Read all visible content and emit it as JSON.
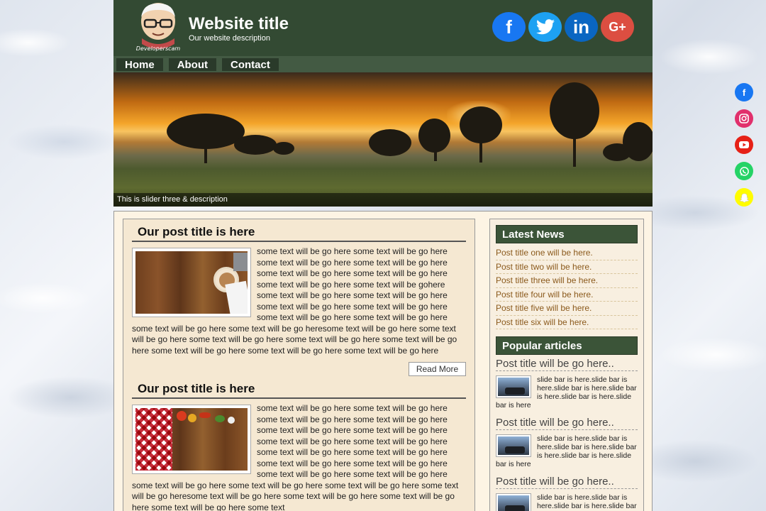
{
  "header": {
    "site_title": "Website title",
    "site_description": "Our website description",
    "logo_text": "Developerscam",
    "socials": [
      "facebook-icon",
      "twitter-icon",
      "linkedin-icon",
      "google-plus-icon"
    ],
    "google_plus_label": "G+",
    "linkedin_label": "in"
  },
  "nav": {
    "items": [
      {
        "label": "Home"
      },
      {
        "label": "About"
      },
      {
        "label": "Contact"
      }
    ]
  },
  "slider": {
    "caption": "This is slider three & description"
  },
  "posts": [
    {
      "title": "Our post title is here",
      "body": "some text will be go here some text will be go here some text will be go here some text will be go here some text will be go here some text will be go here some text will be go here some text will be gohere some text will be go here some text will be go here some text will be go here some text will be go here some text will be go here some text will be go here some text will be go here some text will be go heresome text will be go here some text will be go here some text will be go here some text will be go here some text will be go here some text will be go here some text will be go here some text will be go here",
      "read_more": "Read More"
    },
    {
      "title": "Our post title is here",
      "body": "some text will be go here some text will be go here some text will be go here some text will be go here some text will be go here some text will be go here some text will be go here some text will be go here some text will be go here some text will be go here some text will be go here some text will be go here some text will be go here some text will be go here some text will be go here some text will be go here some text will be go here some text will be go heresome text will be go here some text will be go here some text will be go here some text will be go here some text"
    }
  ],
  "sidebar": {
    "latest_news_heading": "Latest News",
    "latest_news": [
      "Post title one will be here.",
      "Post title two will be here.",
      "Post title three will be here.",
      "Post title four will be here.",
      "Post title five will be here.",
      "Post title six will be here."
    ],
    "popular_heading": "Popular articles",
    "popular": [
      {
        "title": "Post title will be go here..",
        "body": "slide bar is here.slide bar is here.slide bar is here.slide bar is here.slide bar is here.slide bar is here"
      },
      {
        "title": "Post title will be go here..",
        "body": "slide bar is here.slide bar is here.slide bar is here.slide bar is here.slide bar is here.slide bar is here"
      },
      {
        "title": "Post title will be go here..",
        "body": "slide bar is here.slide bar is here.slide bar is here.slide bar is here.slide bar is here.slide bar is here"
      }
    ]
  },
  "floating_socials": [
    "facebook-icon",
    "instagram-icon",
    "youtube-icon",
    "whatsapp-icon",
    "snapchat-icon"
  ]
}
